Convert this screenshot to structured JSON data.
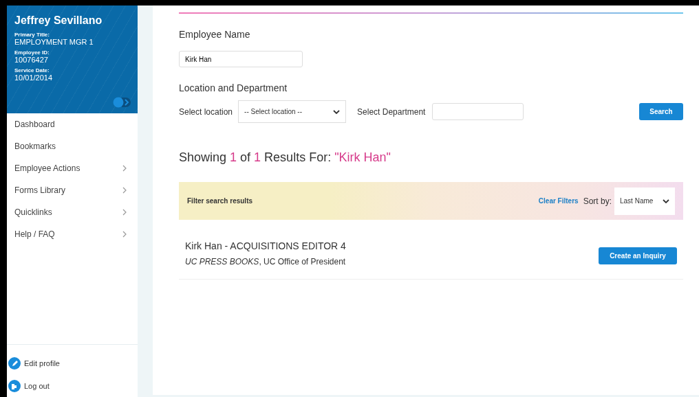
{
  "profile": {
    "name": "Jeffrey Sevillano",
    "fields": [
      {
        "label": "Primary Title:",
        "value": "EMPLOYMENT MGR 1"
      },
      {
        "label": "Employee ID:",
        "value": "10076427"
      },
      {
        "label": "Service Date:",
        "value": "10/01/2014"
      }
    ]
  },
  "menu": [
    {
      "label": "Dashboard",
      "has_submenu": false
    },
    {
      "label": "Bookmarks",
      "has_submenu": false
    },
    {
      "label": "Employee Actions",
      "has_submenu": true
    },
    {
      "label": "Forms Library",
      "has_submenu": true
    },
    {
      "label": "Quicklinks",
      "has_submenu": true
    },
    {
      "label": "Help / FAQ",
      "has_submenu": true
    }
  ],
  "footer_links": [
    {
      "kind": "edit",
      "label": "Edit profile"
    },
    {
      "kind": "logout",
      "label": "Log out"
    }
  ],
  "search": {
    "name_heading": "Employee Name",
    "name_value": "Kirk Han",
    "location_heading": "Location and Department",
    "location_label": "Select location",
    "location_value": "-- Select location --",
    "department_label": "Select Department",
    "button": "Search"
  },
  "results_heading": {
    "prefix": "Showing",
    "current": "1",
    "of": "of",
    "total": "1",
    "label": "Results For:",
    "query": "\"Kirk Han\""
  },
  "filter_bar": {
    "title": "Filter search results",
    "clear": "Clear Filters",
    "sort_label": "Sort by:",
    "sort_value": "Last Name"
  },
  "results": [
    {
      "title": "Kirk Han - ACQUISITIONS EDITOR 4",
      "subtitle": "*UC PRESS BOOKS*, UC Office of President",
      "button": "Create an Inquiry"
    }
  ]
}
